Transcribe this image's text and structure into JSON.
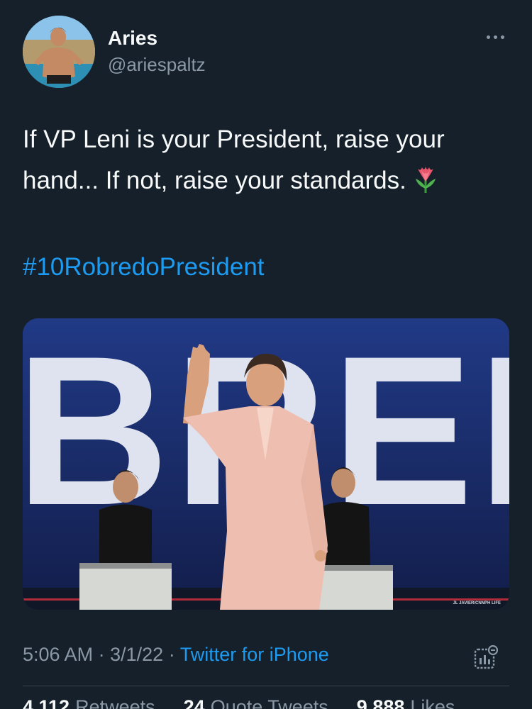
{
  "author": {
    "display_name": "Aries",
    "handle": "@ariespaltz"
  },
  "tweet": {
    "text": "If VP Leni is your President, raise your hand... If not, raise your standards.",
    "emoji_icon": "tulip-icon",
    "hashtag": "#10RobredoPresident"
  },
  "media": {
    "backdrop_text": "BRED",
    "photo_credit": "JL JAVIER/CNNPH LIFE"
  },
  "meta": {
    "time": "5:06 AM",
    "separator": "·",
    "date": "3/1/22",
    "source": "Twitter for iPhone"
  },
  "stats": [
    {
      "count": "4,112",
      "label": "Retweets"
    },
    {
      "count": "24",
      "label": "Quote Tweets"
    },
    {
      "count": "9,888",
      "label": "Likes"
    }
  ],
  "colors": {
    "background": "#15202b",
    "accent": "#1d9bf0",
    "secondary_text": "#8b98a5"
  }
}
